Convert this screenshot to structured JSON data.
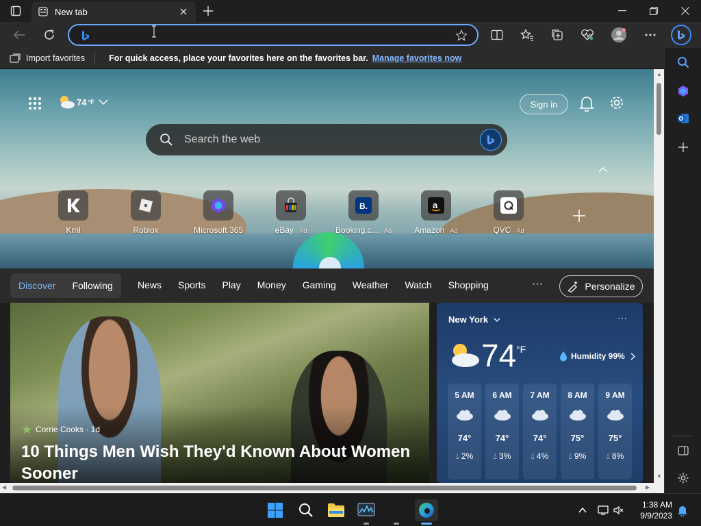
{
  "browser": {
    "tab_title": "New tab",
    "address_value": "",
    "favorites_bar": {
      "import_label": "Import favorites",
      "message": "For quick access, place your favorites here on the favorites bar.",
      "link": "Manage favorites now"
    }
  },
  "newtab": {
    "weather_mini": {
      "temp": "74",
      "unit": "°F"
    },
    "sign_in": "Sign in",
    "search_placeholder": "Search the web",
    "quick_links": [
      {
        "label": "Krnl",
        "ad": ""
      },
      {
        "label": "Roblox",
        "ad": ""
      },
      {
        "label": "Microsoft 365",
        "ad": ""
      },
      {
        "label": "eBay",
        "ad": "· Ad"
      },
      {
        "label": "Booking.c...",
        "ad": "· Ad"
      },
      {
        "label": "Amazon",
        "ad": "· Ad"
      },
      {
        "label": "QVC",
        "ad": "· Ad"
      }
    ],
    "feed_tabs": {
      "discover": "Discover",
      "following": "Following"
    },
    "nav_items": [
      "News",
      "Sports",
      "Play",
      "Money",
      "Gaming",
      "Weather",
      "Watch",
      "Shopping"
    ],
    "nav_more": "···",
    "personalize": "Personalize"
  },
  "article": {
    "source": "Corrie Cooks · 1d",
    "title": "10 Things Men Wish They'd Known About Women Sooner"
  },
  "weather": {
    "city": "New York",
    "more": "···",
    "temp": "74",
    "unit": "°F",
    "humidity": "Humidity 99%",
    "hours": [
      {
        "time": "5 AM",
        "temp": "74°",
        "precip": "2%"
      },
      {
        "time": "6 AM",
        "temp": "74°",
        "precip": "3%"
      },
      {
        "time": "7 AM",
        "temp": "74°",
        "precip": "4%"
      },
      {
        "time": "8 AM",
        "temp": "75°",
        "precip": "9%"
      },
      {
        "time": "9 AM",
        "temp": "75°",
        "precip": "8%"
      }
    ]
  },
  "taskbar": {
    "time": "1:38 AM",
    "date": "9/9/2023"
  },
  "colors": {
    "accent": "#6aa7ff",
    "link": "#84b8ff",
    "weather_card": "#274c7e"
  }
}
